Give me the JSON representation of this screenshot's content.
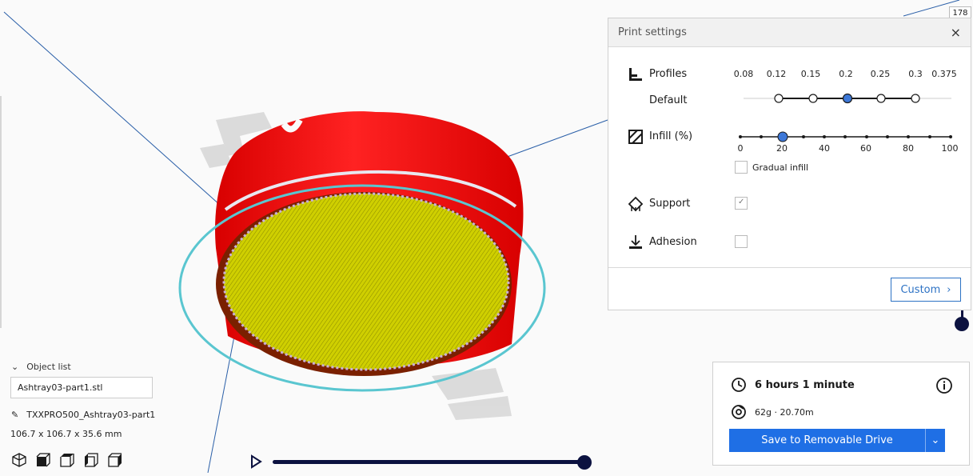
{
  "layer_number": "178",
  "print_settings": {
    "title": "Print settings",
    "close_icon": "close-icon",
    "profiles": {
      "label": "Profiles",
      "sublabel": "Default",
      "ticks": [
        "0.08",
        "0.12",
        "0.15",
        "0.2",
        "0.25",
        "0.3",
        "0.375"
      ],
      "selected": "0.2"
    },
    "infill": {
      "label": "Infill (%)",
      "ticks": [
        "0",
        "20",
        "40",
        "60",
        "80",
        "100"
      ],
      "value": 20,
      "gradual_label": "Gradual infill",
      "gradual_checked": false
    },
    "support": {
      "label": "Support",
      "checked": true
    },
    "adhesion": {
      "label": "Adhesion",
      "checked": false
    },
    "custom_label": "Custom"
  },
  "object_list": {
    "title": "Object list",
    "input_value": "Ashtray03-part1.stl",
    "object_name": "TXXPRO500_Ashtray03-part1",
    "dimensions": "106.7 x 106.7 x 35.6 mm",
    "view_icons": [
      "3d-view-icon",
      "front-view-icon",
      "top-view-icon",
      "left-view-icon",
      "right-view-icon"
    ]
  },
  "job": {
    "time": "6 hours 1 minute",
    "material": "62g · 20.70m",
    "save_label": "Save to Removable Drive"
  },
  "colors": {
    "accent": "#1f6fe5",
    "slider_dark": "#0c1240",
    "shell_red": "#ee1111",
    "top_yellow": "#d4d400",
    "ring_cyan": "#5ac6d0"
  }
}
